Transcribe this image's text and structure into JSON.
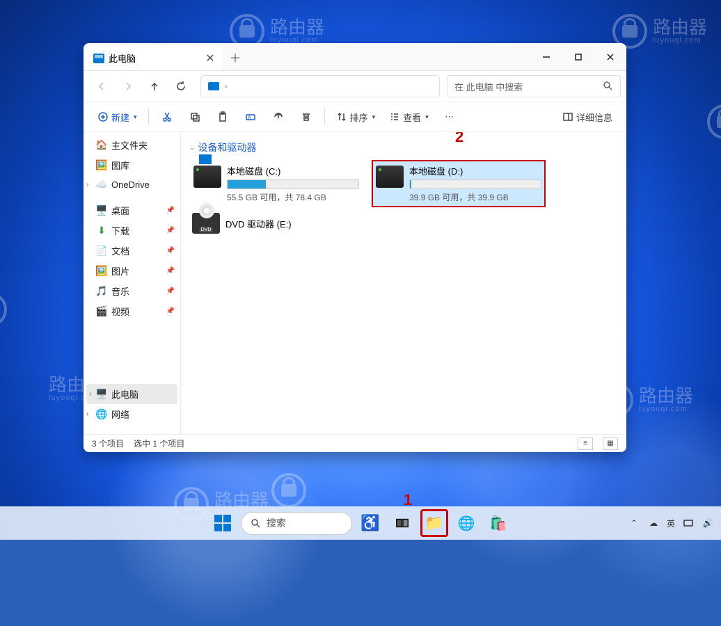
{
  "watermark": {
    "title": "路由器",
    "subtitle": "luyouqi.com"
  },
  "window": {
    "tab_title": "此电脑",
    "search_placeholder": "在 此电脑 中搜索",
    "toolbar": {
      "new": "新建",
      "sort": "排序",
      "view": "查看",
      "details": "详细信息"
    },
    "sidebar": {
      "home": "主文件夹",
      "gallery": "图库",
      "onedrive": "OneDrive",
      "desktop": "桌面",
      "downloads": "下载",
      "documents": "文档",
      "pictures": "图片",
      "music": "音乐",
      "videos": "视频",
      "this_pc": "此电脑",
      "network": "网络"
    },
    "content": {
      "section": "设备和驱动器",
      "drive_c": {
        "name": "本地磁盘 (C:)",
        "status": "55.5 GB 可用，共 78.4 GB",
        "fill_pct": 29
      },
      "drive_d": {
        "name": "本地磁盘 (D:)",
        "status": "39.9 GB 可用，共 39.9 GB",
        "fill_pct": 1
      },
      "dvd": {
        "name": "DVD 驱动器 (E:)"
      }
    },
    "statusbar": {
      "items": "3 个项目",
      "selected": "选中 1 个项目"
    }
  },
  "taskbar": {
    "search": "搜索",
    "ime": "英"
  },
  "annotations": {
    "one": "1",
    "two": "2"
  }
}
